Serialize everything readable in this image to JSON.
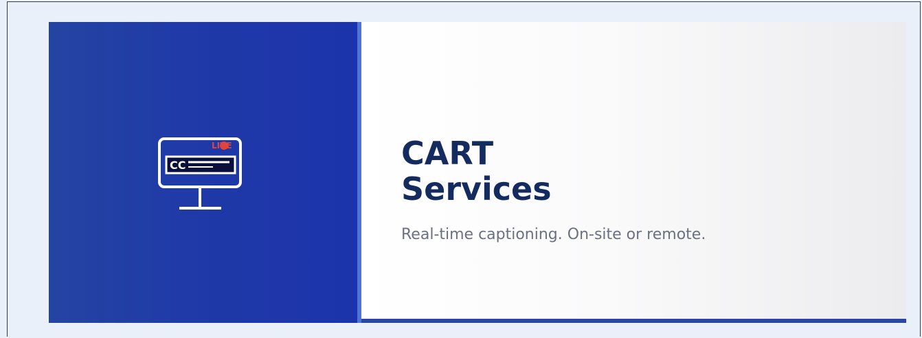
{
  "service": {
    "icon": "live-captioning-monitor-icon",
    "icon_cc_text": "CC",
    "icon_live_text": "LIVE",
    "title_line1": "CART",
    "title_line2": "Services",
    "subtitle": "Real-time captioning. On-site or remote."
  },
  "colors": {
    "left_panel": "#1f38a8",
    "accent_bar": "#2846a6",
    "divider": "#4d74d6",
    "title": "#142b5f",
    "subtitle": "#6a7180",
    "live_dot": "#e0453d"
  }
}
